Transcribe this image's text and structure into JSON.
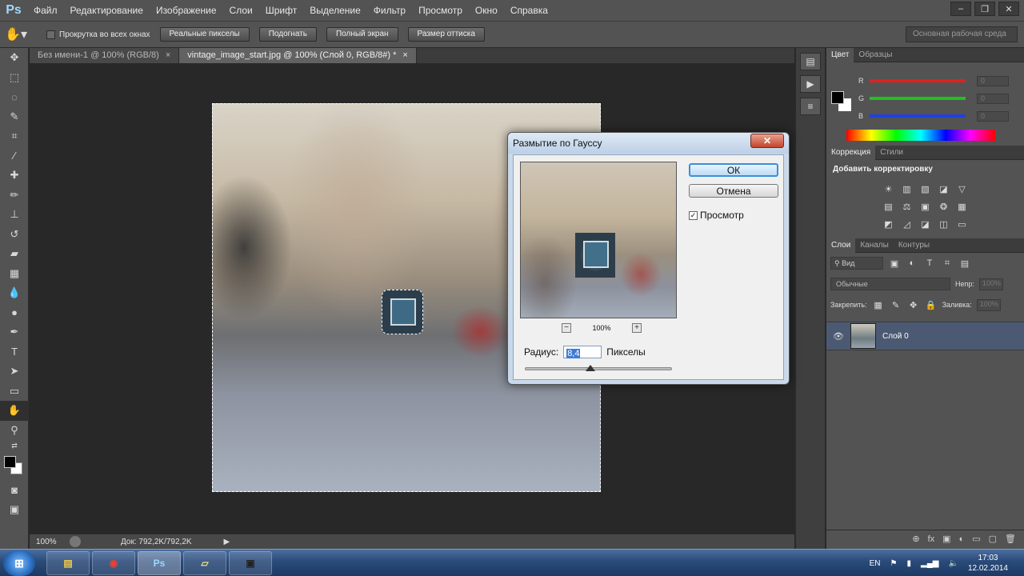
{
  "menu": {
    "logo": "Ps",
    "items": [
      "Файл",
      "Редактирование",
      "Изображение",
      "Слои",
      "Шрифт",
      "Выделение",
      "Фильтр",
      "Просмотр",
      "Окно",
      "Справка"
    ]
  },
  "window_controls": {
    "minimize": "–",
    "restore": "❐",
    "close": "✕"
  },
  "options": {
    "scroll_all_label": "Прокрутка во всех окнах",
    "actual_pixels": "Реальные пикселы",
    "fit_screen": "Подогнать",
    "full_screen": "Полный экран",
    "print_size": "Размер оттиска",
    "workspace": "Основная рабочая среда"
  },
  "tabs": [
    {
      "label": "Без имени-1 @ 100% (RGB/8)",
      "close": "×"
    },
    {
      "label": "vintage_image_start.jpg @ 100% (Слой 0, RGB/8#) *",
      "close": "×"
    }
  ],
  "status": {
    "zoom": "100%",
    "doc_size": "Док: 792,2K/792,2K",
    "arrow": "▶"
  },
  "color_panel": {
    "tabs": [
      "Цвет",
      "Образцы"
    ],
    "rows": [
      {
        "label": "R",
        "value": "0",
        "color": "#e02020"
      },
      {
        "label": "G",
        "value": "0",
        "color": "#20c020"
      },
      {
        "label": "B",
        "value": "0",
        "color": "#2040e0"
      }
    ]
  },
  "adjustments": {
    "tabs": [
      "Коррекция",
      "Стили"
    ],
    "title": "Добавить корректировку",
    "row1": [
      "☀",
      "▥",
      "▧",
      "◪",
      "▽"
    ],
    "row2": [
      "▤",
      "⚖",
      "▣",
      "❂",
      "▦"
    ],
    "row3": [
      "◩",
      "◿",
      "◪",
      "◫",
      "▭"
    ]
  },
  "layers": {
    "tabs": [
      "Слои",
      "Каналы",
      "Контуры"
    ],
    "filter_kind": "Вид",
    "blend_mode": "Обычные",
    "opacity_label": "Непр:",
    "opacity": "100%",
    "lock_label": "Закрепить:",
    "fill_label": "Заливка:",
    "fill": "100%",
    "layer_name": "Слой 0"
  },
  "dialog": {
    "title": "Размытие по Гауссу",
    "close": "✕",
    "ok": "ОК",
    "cancel": "Отмена",
    "preview_label": "Просмотр",
    "preview_checked": "✓",
    "zoom": "100%",
    "zoom_out": "−",
    "zoom_in": "+",
    "radius_label": "Радиус:",
    "radius_value": "8,4",
    "radius_unit": "Пикселы"
  },
  "taskbar": {
    "start": "⊞",
    "apps": [
      {
        "name": "Проводник",
        "glyph": "▤",
        "color": "#f2c94c"
      },
      {
        "name": "Chrome",
        "glyph": "◉",
        "color": "#e94235"
      },
      {
        "name": "Photoshop",
        "glyph": "Ps",
        "color": "#9fd7ff"
      },
      {
        "name": "Notes",
        "glyph": "▱",
        "color": "#e6e28a"
      },
      {
        "name": "Camera",
        "glyph": "▣",
        "color": "#333333"
      }
    ],
    "lang": "EN",
    "time": "17:03",
    "date": "12.02.2014"
  }
}
